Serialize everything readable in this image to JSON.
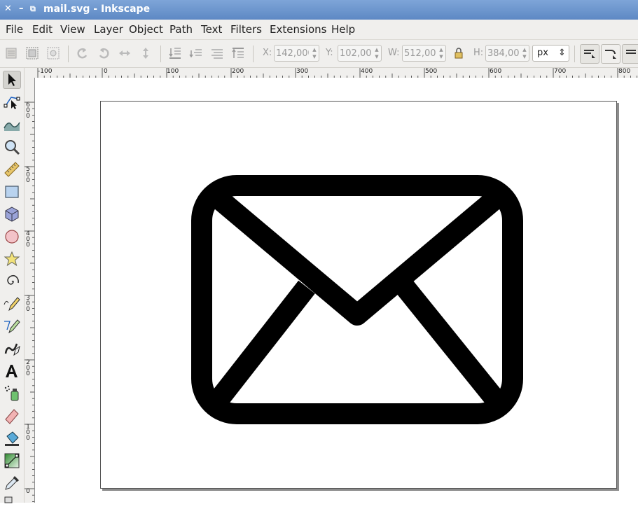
{
  "window": {
    "title": "mail.svg - Inkscape",
    "close_glyph": "✕",
    "minimize_glyph": "–",
    "restore_glyph": "⧉"
  },
  "menubar": [
    "File",
    "Edit",
    "View",
    "Layer",
    "Object",
    "Path",
    "Text",
    "Filters",
    "Extensions",
    "Help"
  ],
  "toolbar": {
    "x": {
      "label": "X:",
      "value": "142,000"
    },
    "y": {
      "label": "Y:",
      "value": "102,000"
    },
    "w": {
      "label": "W:",
      "value": "512,000"
    },
    "h": {
      "label": "H:",
      "value": "384,000"
    },
    "unit": "px",
    "spin_up": "▲",
    "spin_down": "▼",
    "unit_arrows": "⇕"
  },
  "tools": [
    "selector-tool-icon",
    "node-tool-icon",
    "tweak-tool-icon",
    "zoom-tool-icon",
    "measure-tool-icon",
    "rectangle-tool-icon",
    "box-3d-tool-icon",
    "ellipse-tool-icon",
    "star-tool-icon",
    "spiral-tool-icon",
    "pencil-tool-icon",
    "pen-tool-icon",
    "calligraphy-tool-icon",
    "text-tool-icon",
    "spray-tool-icon",
    "eraser-tool-icon",
    "paint-bucket-tool-icon",
    "gradient-tool-icon",
    "dropper-tool-icon",
    "connector-tool-icon"
  ],
  "ruler": {
    "horizontal_labels": [
      "-100",
      "0",
      "100",
      "200",
      "300",
      "400",
      "500",
      "600",
      "700",
      "800"
    ],
    "vertical_labels": [
      [
        "6",
        "0",
        "0"
      ],
      [
        "5",
        "0",
        "0"
      ],
      [
        "4",
        "0",
        "0"
      ],
      [
        "3",
        "0",
        "0"
      ],
      [
        "2",
        "0",
        "0"
      ],
      [
        "1",
        "0",
        "0"
      ],
      [
        "0"
      ]
    ]
  },
  "drawing": {
    "icon": "mail-envelope-icon",
    "stroke_color": "#000000",
    "fill_color": "#ffffff"
  }
}
